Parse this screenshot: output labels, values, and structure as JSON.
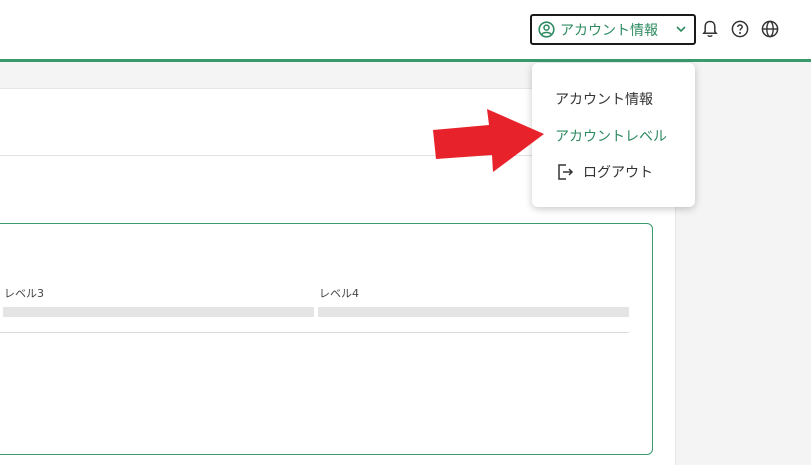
{
  "header": {
    "account_button_label": "アカウント情報"
  },
  "dropdown": {
    "items": [
      {
        "label": "アカウント情報"
      },
      {
        "label": "アカウントレベル"
      },
      {
        "label": "ログアウト"
      }
    ]
  },
  "levels": [
    {
      "label": "レベル3"
    },
    {
      "label": "レベル4"
    }
  ],
  "colors": {
    "accent": "#2e8b61",
    "accent_border": "#3a9a6e",
    "annotation_arrow": "#e8222a"
  }
}
